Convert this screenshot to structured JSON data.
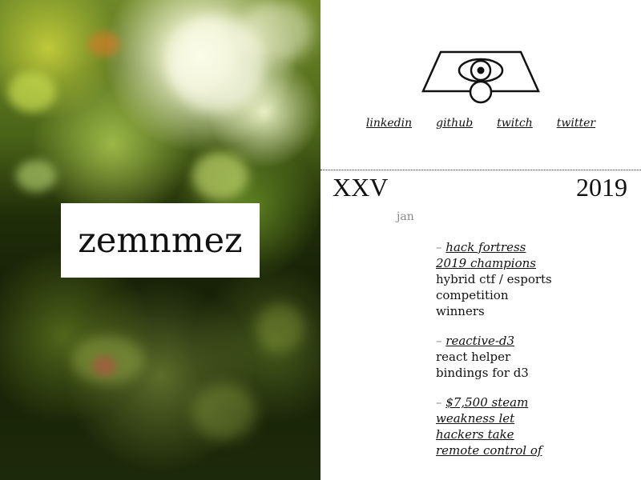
{
  "brand": {
    "name": "zemnmez"
  },
  "social": [
    {
      "label": "linkedin"
    },
    {
      "label": "github"
    },
    {
      "label": "twitch"
    },
    {
      "label": "twitter"
    }
  ],
  "timeline": {
    "numeral": "XXV",
    "year": "2019",
    "month": "jan",
    "entries": [
      {
        "dash": "–",
        "title": "hack fortress 2019 champions",
        "desc": "hybrid ctf / esports competition winners"
      },
      {
        "dash": "–",
        "title": "reactive-d3",
        "desc": "react helper bindings for d3"
      },
      {
        "dash": "–",
        "title": "$7,500 steam weakness let hackers take remote control of",
        "desc": ""
      }
    ]
  },
  "icons": {
    "logo": "eye-pyramid-logo-icon"
  },
  "colors": {
    "text": "#111111",
    "muted": "#888888",
    "background": "#ffffff"
  }
}
